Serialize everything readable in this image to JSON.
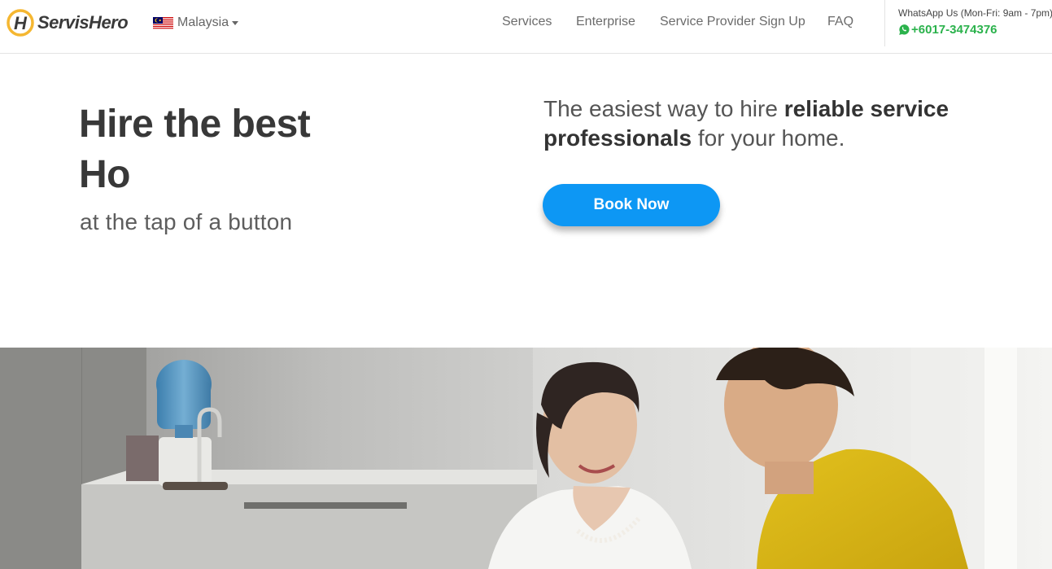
{
  "header": {
    "brand": "ServisHero",
    "country": "Malaysia",
    "nav": [
      "Services",
      "Enterprise",
      "Service Provider Sign Up",
      "FAQ"
    ],
    "contact_label": "WhatsApp Us (Mon-Fri: 9am - 7pm)",
    "contact_phone": "+6017-3474376"
  },
  "hero": {
    "title_line1": "Hire the best",
    "title_line2": "Ho",
    "subtitle": "at the tap of a button",
    "tagline_pre": "The easiest way to hire ",
    "tagline_bold": "reliable service professionals",
    "tagline_post": " for your home.",
    "cta": "Book Now"
  },
  "colors": {
    "accent": "#0d97f4",
    "whatsapp": "#2bb24c",
    "logo": "#f5b731"
  }
}
